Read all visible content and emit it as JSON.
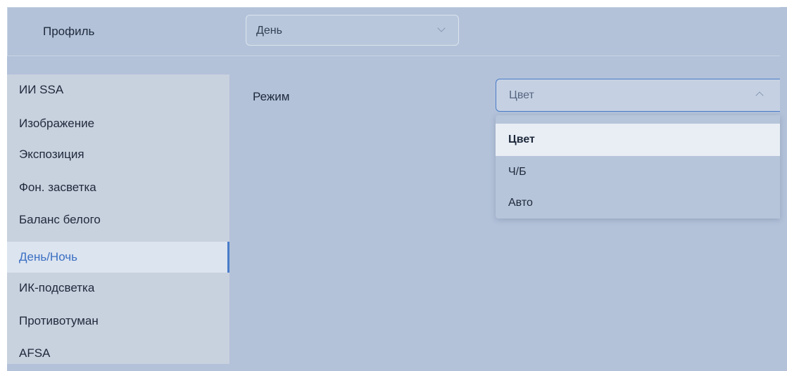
{
  "profile": {
    "label": "Профиль",
    "selected": "День"
  },
  "sidebar": {
    "items": [
      {
        "label": "ИИ SSA"
      },
      {
        "label": "Изображение"
      },
      {
        "label": "Экспозиция"
      },
      {
        "label": "Фон. засветка"
      },
      {
        "label": "Баланс белого"
      },
      {
        "label": "День/Ночь",
        "active": true
      },
      {
        "label": "ИК-подсветка"
      },
      {
        "label": "Противотуман"
      },
      {
        "label": "AFSA"
      }
    ]
  },
  "mode": {
    "label": "Режим",
    "selected": "Цвет",
    "options": [
      "Цвет",
      "Ч/Б",
      "Авто"
    ]
  },
  "colors": {
    "accent": "#4a7cc9",
    "background": "#b3c2d9",
    "sidebar": "#c8d1de"
  }
}
